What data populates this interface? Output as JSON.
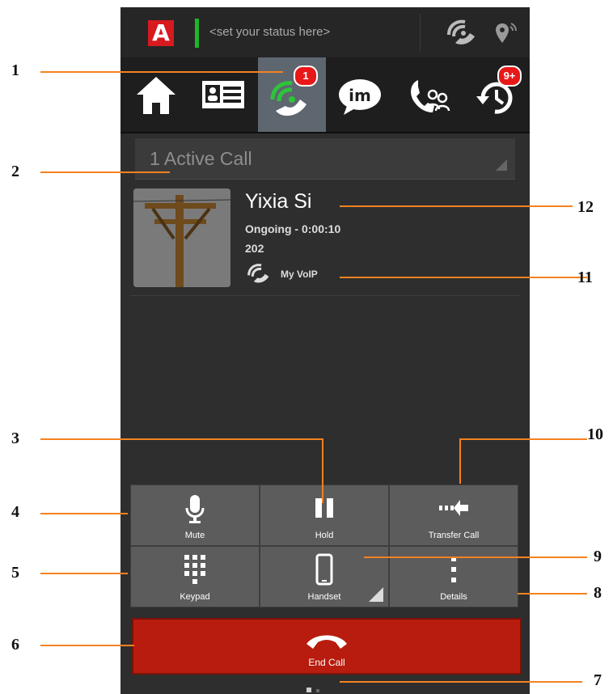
{
  "statusbar": {
    "logo_letter": "A",
    "status_placeholder": "<set your status here>",
    "icons": [
      "voip-signal-icon",
      "location-icon"
    ]
  },
  "tabs": [
    {
      "name": "home",
      "icon": "home-icon"
    },
    {
      "name": "contacts",
      "icon": "contact-card-icon"
    },
    {
      "name": "phone",
      "icon": "phone-handset-icon",
      "badge": "1",
      "active": true
    },
    {
      "name": "im",
      "icon": "im-bubble-icon"
    },
    {
      "name": "conference",
      "icon": "conference-call-icon"
    },
    {
      "name": "history",
      "icon": "history-clock-icon",
      "badge": "9+"
    }
  ],
  "active_calls": {
    "label": "1 Active Call"
  },
  "call": {
    "name": "Yixia Si",
    "status": "Ongoing - 0:00:10",
    "number": "202",
    "account": "My VoIP"
  },
  "controls": {
    "mute": "Mute",
    "hold": "Hold",
    "transfer": "Transfer Call",
    "keypad": "Keypad",
    "handset": "Handset",
    "details": "Details",
    "end_call": "End Call"
  },
  "callouts": [
    "1",
    "2",
    "3",
    "4",
    "5",
    "6",
    "7",
    "8",
    "9",
    "10",
    "11",
    "12"
  ],
  "colors": {
    "accent_callout": "#f58220",
    "end_call": "#b71c0e",
    "presence": "#1fb52b",
    "badge": "#e81818",
    "brand": "#d71920"
  }
}
